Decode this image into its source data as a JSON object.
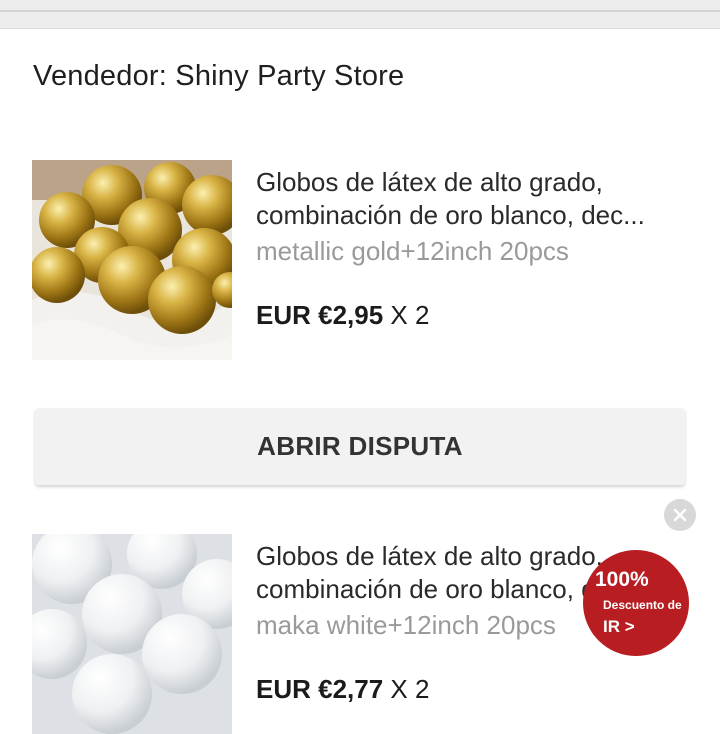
{
  "seller": {
    "label": "Vendedor: Shiny Party Store"
  },
  "products": [
    {
      "title_line1": "Globos de látex de alto grado,",
      "title_line2": "combinación de oro blanco, dec...",
      "variant": "metallic gold+12inch 20pcs",
      "price": "EUR €2,95",
      "quantity": "X 2",
      "image": "gold-balloons-image"
    },
    {
      "title_line1": "Globos de látex de alto grado,",
      "title_line2": "combinación de oro blanco, dec...",
      "variant": "maka white+12inch 20pcs",
      "price": "EUR €2,77",
      "quantity": "X 2",
      "image": "white-balloons-image"
    }
  ],
  "dispute_button": {
    "label": "ABRIR DISPUTA"
  },
  "promo_badge": {
    "percent": "100%",
    "description": "Descuento de",
    "cta": "IR >",
    "color": "#b81d22"
  },
  "close_icon": "close-icon"
}
